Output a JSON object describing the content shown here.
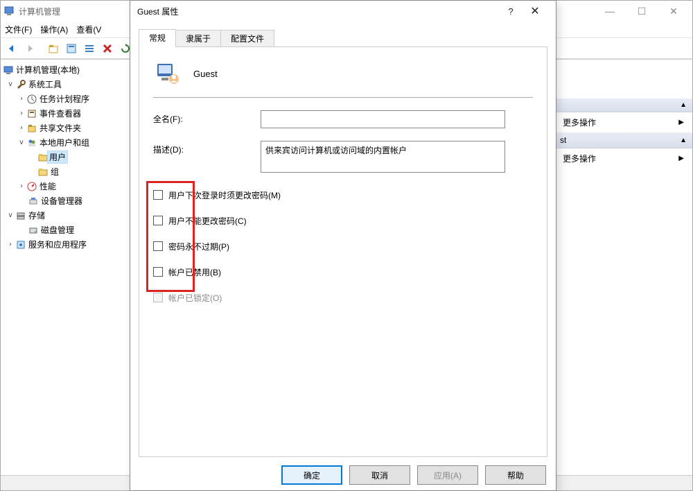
{
  "bgWindow": {
    "title": "计算机管理",
    "menus": [
      "文件(F)",
      "操作(A)",
      "查看(V"
    ],
    "winctrl": {
      "min": "—",
      "max": "☐",
      "close": "✕"
    }
  },
  "tree": {
    "root": "计算机管理(本地)",
    "systools": "系统工具",
    "task": "任务计划程序",
    "event": "事件查看器",
    "share": "共享文件夹",
    "localusers": "本地用户和组",
    "users": "用户",
    "groups": "组",
    "perf": "性能",
    "devmgr": "设备管理器",
    "storage": "存储",
    "disk": "磁盘管理",
    "services": "服务和应用程序"
  },
  "actions": {
    "more1": "更多操作",
    "sub": "st",
    "more2": "更多操作"
  },
  "dialog": {
    "title": "Guest 属性",
    "tabs": {
      "general": "常规",
      "member": "隶属于",
      "profile": "配置文件"
    },
    "header_name": "Guest",
    "fullname_label": "全名(F):",
    "fullname_value": "",
    "desc_label": "描述(D):",
    "desc_value": "供来宾访问计算机或访问域的内置帐户",
    "checks": {
      "must_change": "用户下次登录时须更改密码(M)",
      "cannot_change": "用户不能更改密码(C)",
      "never_expire": "密码永不过期(P)",
      "disabled": "帐户已禁用(B)",
      "locked": "帐户已锁定(O)"
    },
    "buttons": {
      "ok": "确定",
      "cancel": "取消",
      "apply": "应用(A)",
      "help": "帮助"
    },
    "help": "?",
    "close": "✕"
  }
}
